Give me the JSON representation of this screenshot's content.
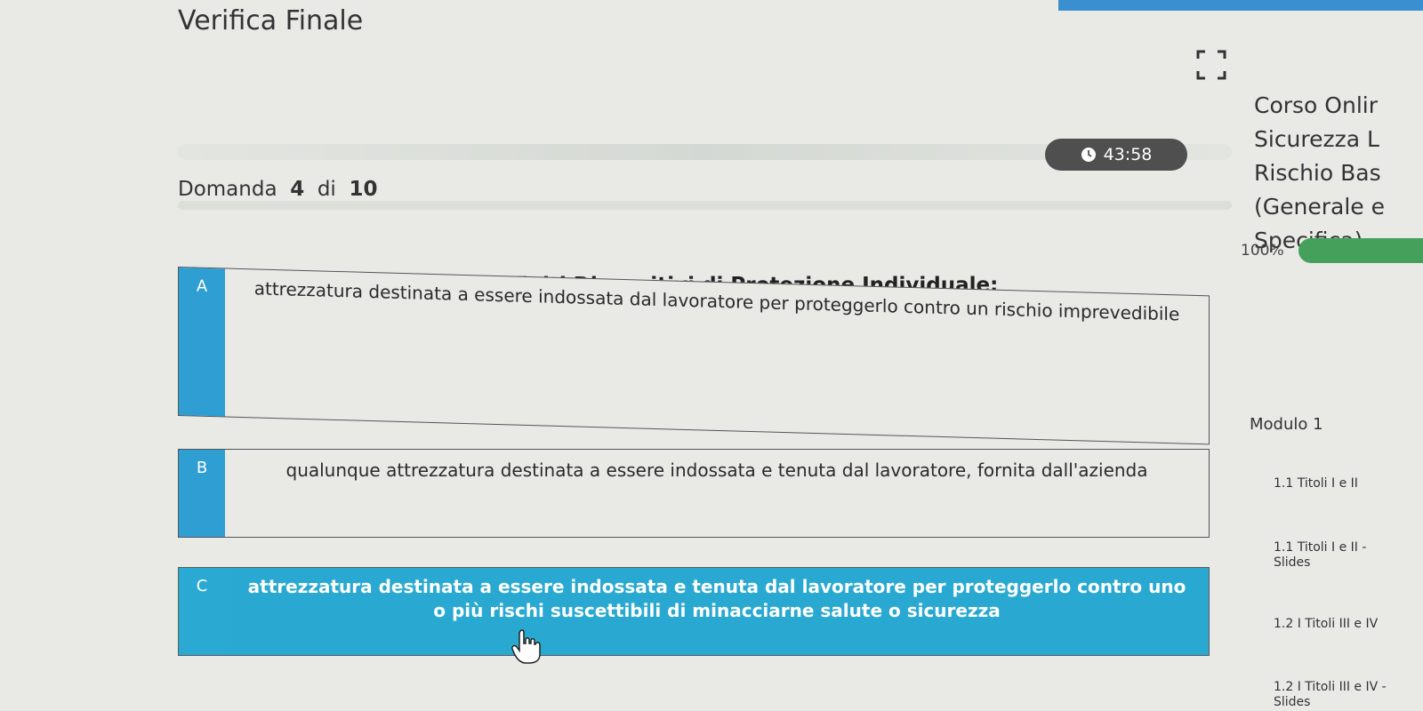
{
  "header": {
    "title": "Verifica Finale",
    "timer": "43:58",
    "question_label": "Domanda",
    "question_current": "4",
    "question_of": "di",
    "question_total": "10"
  },
  "question": {
    "text": "Sono definiti Dispositivi di Protezione Individuale:"
  },
  "answers": [
    {
      "letter": "A",
      "text": "attrezzatura destinata a essere indossata dal lavoratore per proteggerlo contro un rischio imprevedibile"
    },
    {
      "letter": "B",
      "text": "qualunque attrezzatura destinata a essere indossata e tenuta dal lavoratore, fornita dall'azienda"
    },
    {
      "letter": "C",
      "text": "attrezzatura destinata a essere indossata e tenuta dal lavoratore per proteggerlo contro uno o più rischi suscettibili di minacciarne salute o sicurezza"
    }
  ],
  "sidebar": {
    "course_lines": [
      "Corso Onlir",
      "Sicurezza L",
      "Rischio Bas",
      "(Generale e",
      "Specifica)"
    ],
    "progress_label": "100%",
    "progress": 1.0,
    "module": "Modulo 1",
    "lessons": [
      {
        "line1": "1.1 Titoli I e II",
        "line2": ""
      },
      {
        "line1": "1.1 Titoli I e II -",
        "line2": "Slides"
      },
      {
        "line1": "1.2 I Titoli III e IV",
        "line2": ""
      },
      {
        "line1": "1.2 I Titoli III e IV -",
        "line2": "Slides"
      }
    ]
  },
  "colors": {
    "accent": "#2f9ed3",
    "selected_answer": "#29a9d1",
    "progress_green": "#45a05c",
    "timer_bg": "#4f4f4f",
    "top_bar": "#3a8fd1"
  },
  "icons": [
    "fullscreen-icon",
    "clock-icon",
    "hand-cursor-icon"
  ]
}
